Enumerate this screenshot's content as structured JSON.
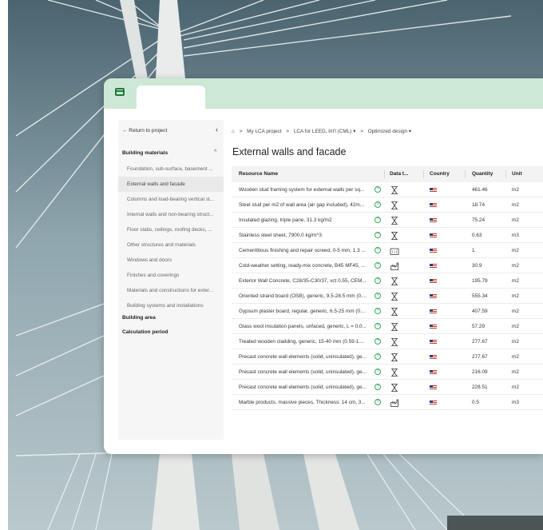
{
  "sidebar": {
    "back_label": "← Return to project",
    "collapse_icon": "chevron-left-icon",
    "sections": {
      "building_materials": "Building materials",
      "building_area": "Building area",
      "calculation_period": "Calculation period"
    },
    "items": [
      {
        "label": "Foundation, sub-surface, basement ..."
      },
      {
        "label": "External walls and facade"
      },
      {
        "label": "Columns and load-bearing vertical st..."
      },
      {
        "label": "Internal walls and non-bearing struct..."
      },
      {
        "label": "Floor slabs, ceilings, roofing decks, ..."
      },
      {
        "label": "Other structures and materials"
      },
      {
        "label": "Windows and doors"
      },
      {
        "label": "Finishes and coverings"
      },
      {
        "label": "Materials and constructions for exter..."
      },
      {
        "label": "Building systems and installations"
      }
    ]
  },
  "breadcrumb": {
    "sep": ">",
    "items": [
      {
        "label": "My LCA project"
      },
      {
        "label": "LCA for LEED, Int'l (CML) ▾"
      },
      {
        "label": "Optimized design ▾"
      }
    ]
  },
  "page_title": "External walls and facade",
  "table": {
    "columns": [
      {
        "label": "Resource Name"
      },
      {
        "label": "Data t..."
      },
      {
        "label": "Country"
      },
      {
        "label": "Quantity"
      },
      {
        "label": "Unit"
      }
    ],
    "rows": [
      {
        "name": "Wooden stud framing system for external walls per sq...",
        "data_type_icon": "generic-data-icon",
        "quantity": "461.46",
        "unit": "m2"
      },
      {
        "name": "Steel stud per m2 of wall area (air gap included), 42m...",
        "data_type_icon": "generic-data-icon",
        "quantity": "18.74",
        "unit": "m2"
      },
      {
        "name": "Insulated glazing, triple pane, 31.3 kg/m2",
        "data_type_icon": "generic-data-icon",
        "quantity": "75.24",
        "unit": "m2"
      },
      {
        "name": "Stainless steel sheet, 7900.0 kg/m^3",
        "data_type_icon": "generic-data-icon",
        "quantity": "0.63",
        "unit": "m3"
      },
      {
        "name": "Cementitious finishing and repair screed, 0-5 mm, 1.3 ...",
        "data_type_icon": "factory-icon",
        "quantity": "1",
        "unit": "m2"
      },
      {
        "name": "Cold-weather setting, ready-mix concrete, B45 MF45, ...",
        "data_type_icon": "industry-average-icon",
        "quantity": "30.9",
        "unit": "m2"
      },
      {
        "name": "Exterior Wall Concrete, C28/35-C30/37, vct 0.55, CEM...",
        "data_type_icon": "generic-data-icon",
        "quantity": "195.79",
        "unit": "m2"
      },
      {
        "name": "Oriented strand board (OSB), generic, 9.5-28.5 mm (0....",
        "data_type_icon": "generic-data-icon",
        "quantity": "555.34",
        "unit": "m2"
      },
      {
        "name": "Gypsum plaster board, regular, generic, 6.5-25 mm (0....",
        "data_type_icon": "generic-data-icon",
        "quantity": "407.59",
        "unit": "m2"
      },
      {
        "name": "Glass wool insulation panels, unfaced, generic, L = 0.0...",
        "data_type_icon": "generic-data-icon",
        "quantity": "57.29",
        "unit": "m2"
      },
      {
        "name": "Treated wooden cladding, generic, 15-40 mm (0.59-1....",
        "data_type_icon": "generic-data-icon",
        "quantity": "277.67",
        "unit": "m2"
      },
      {
        "name": "Precast concrete wall elements (solid, uninsulated), ge...",
        "data_type_icon": "generic-data-icon",
        "quantity": "277.67",
        "unit": "m2"
      },
      {
        "name": "Precast concrete wall elements (solid, uninsulated), ge...",
        "data_type_icon": "generic-data-icon",
        "quantity": "216.09",
        "unit": "m2"
      },
      {
        "name": "Precast concrete wall elements (solid, uninsulated), ge...",
        "data_type_icon": "generic-data-icon",
        "quantity": "228.51",
        "unit": "m2"
      },
      {
        "name": "Marble products, massive pieces, Thickness: 14 cm, 3...",
        "data_type_icon": "industry-average-icon",
        "quantity": "0.5",
        "unit": "m3"
      }
    ]
  },
  "colors": {
    "topbar": "#cde9d6",
    "brand_green": "#1f7a41",
    "help_green": "#3fa45f"
  }
}
